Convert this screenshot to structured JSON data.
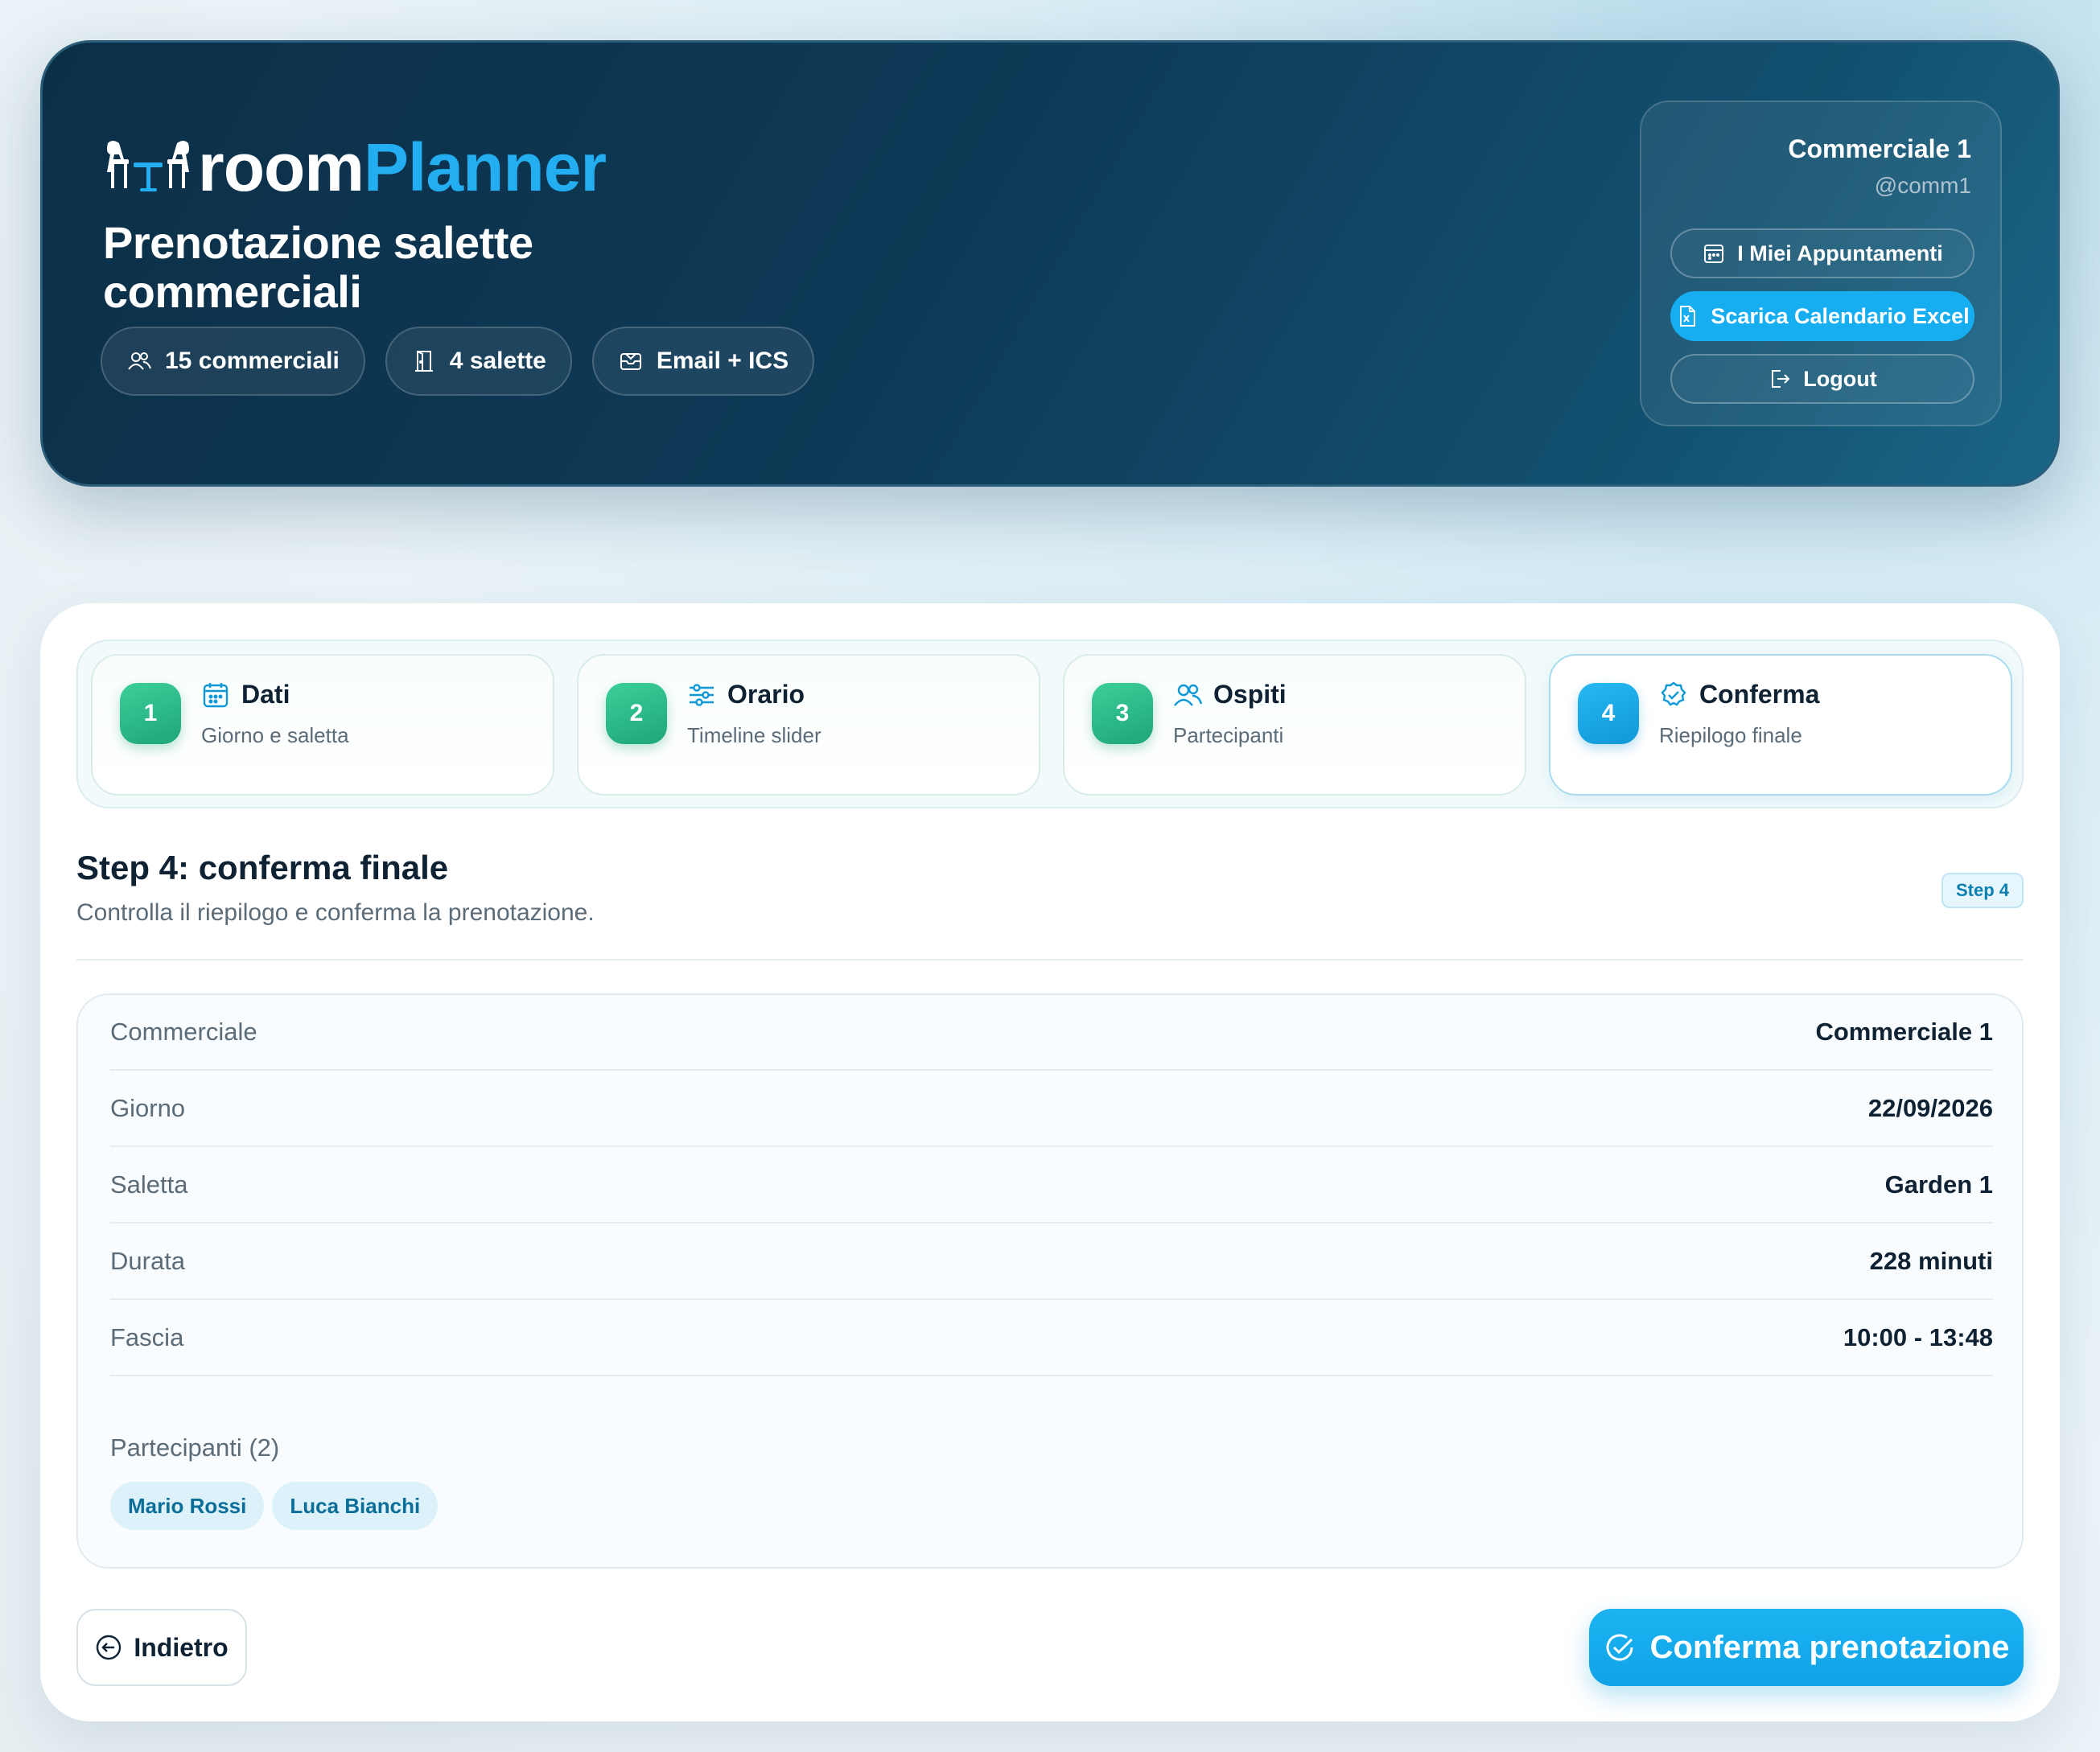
{
  "brand": {
    "part1": "room",
    "part2": "Planner",
    "icon": "chairs-table-icon"
  },
  "header": {
    "title": "Prenotazione salette commerciali",
    "chips": [
      {
        "icon": "users-icon",
        "label": "15 commerciali"
      },
      {
        "icon": "door-icon",
        "label": "4 salette"
      },
      {
        "icon": "mail-icon",
        "label": "Email + ICS"
      }
    ]
  },
  "user": {
    "name": "Commerciale 1",
    "handle": "@comm1",
    "appointments_label": "I Miei Appuntamenti",
    "excel_label": "Scarica Calendario Excel",
    "logout_label": "Logout"
  },
  "stepper": [
    {
      "number": "1",
      "icon": "calendar-icon",
      "title": "Dati",
      "subtitle": "Giorno e saletta",
      "status": "done"
    },
    {
      "number": "2",
      "icon": "sliders-icon",
      "title": "Orario",
      "subtitle": "Timeline slider",
      "status": "done"
    },
    {
      "number": "3",
      "icon": "users-icon",
      "title": "Ospiti",
      "subtitle": "Partecipanti",
      "status": "done"
    },
    {
      "number": "4",
      "icon": "check-badge-icon",
      "title": "Conferma",
      "subtitle": "Riepilogo finale",
      "status": "active"
    }
  ],
  "section": {
    "title": "Step 4: conferma finale",
    "description": "Controlla il riepilogo e conferma la prenotazione.",
    "badge": "Step 4"
  },
  "summary": {
    "rows": [
      {
        "label": "Commerciale",
        "value": "Commerciale 1"
      },
      {
        "label": "Giorno",
        "value": "22/09/2026"
      },
      {
        "label": "Saletta",
        "value": "Garden 1"
      },
      {
        "label": "Durata",
        "value": "228 minuti"
      },
      {
        "label": "Fascia",
        "value": "10:00 - 13:48"
      }
    ],
    "participants_label": "Partecipanti (2)",
    "participants": [
      "Mario Rossi",
      "Luca Bianchi"
    ]
  },
  "actions": {
    "back_label": "Indietro",
    "confirm_label": "Conferma prenotazione"
  },
  "colors": {
    "accent": "#16aef0",
    "step_done": "#2cbf8a",
    "header_bg": "#0e3a57"
  }
}
